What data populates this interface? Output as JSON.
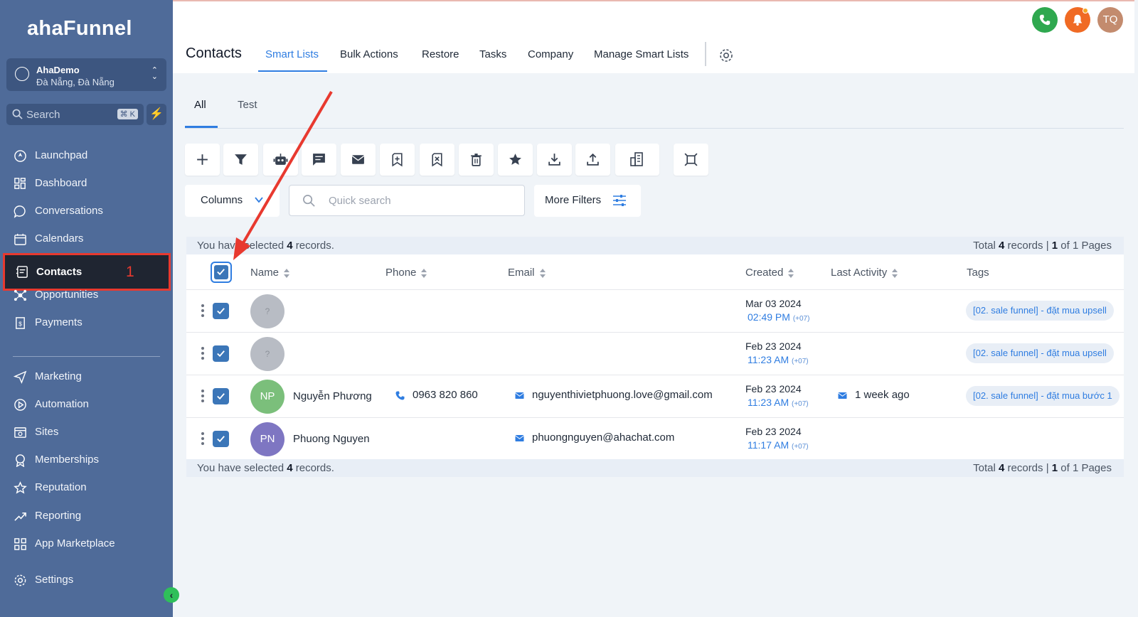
{
  "brand": {
    "logo": "ahaFunnel"
  },
  "account": {
    "name": "AhaDemo",
    "location": "Đà Nẵng, Đà Nẵng"
  },
  "sidebar_search": {
    "placeholder": "Search",
    "shortcut": "⌘ K"
  },
  "sidebar": {
    "items": [
      {
        "label": "Launchpad",
        "icon": "rocket-icon"
      },
      {
        "label": "Dashboard",
        "icon": "grid-icon"
      },
      {
        "label": "Conversations",
        "icon": "chat-bubble-icon"
      },
      {
        "label": "Calendars",
        "icon": "calendar-icon"
      },
      {
        "label": "Contacts",
        "icon": "contact-card-icon",
        "active": true,
        "annotation": "1"
      },
      {
        "label": "Opportunities",
        "icon": "network-icon"
      },
      {
        "label": "Payments",
        "icon": "receipt-icon"
      },
      {
        "label": "Marketing",
        "icon": "send-icon"
      },
      {
        "label": "Automation",
        "icon": "automation-icon"
      },
      {
        "label": "Sites",
        "icon": "sites-icon"
      },
      {
        "label": "Memberships",
        "icon": "badge-icon"
      },
      {
        "label": "Reputation",
        "icon": "star-icon"
      },
      {
        "label": "Reporting",
        "icon": "trend-icon"
      },
      {
        "label": "App Marketplace",
        "icon": "apps-icon"
      },
      {
        "label": "Settings",
        "icon": "gear-icon"
      }
    ]
  },
  "header": {
    "title": "Contacts",
    "tabs": [
      "Smart Lists",
      "Bulk Actions",
      "Restore",
      "Tasks",
      "Company",
      "Manage Smart Lists"
    ],
    "active_tab": "Smart Lists",
    "user_initials": "TQ"
  },
  "sub_tabs": [
    "All",
    "Test"
  ],
  "toolbar": {
    "icons": [
      "add-icon",
      "filter-icon",
      "robot-icon",
      "message-icon",
      "email-icon",
      "tag-add-icon",
      "tag-remove-icon",
      "trash-icon",
      "star-icon",
      "download-icon",
      "upload-icon",
      "company-icon",
      "merge-icon"
    ]
  },
  "controls": {
    "columns_label": "Columns",
    "quick_search_placeholder": "Quick search",
    "more_filters_label": "More Filters"
  },
  "selection": {
    "prefix": "You have selected ",
    "count": "4",
    "suffix": " records.",
    "total_prefix": "Total ",
    "total_count": "4",
    "total_mid": " records | ",
    "page_current": "1",
    "page_suffix": " of 1 Pages"
  },
  "table": {
    "columns": [
      "Name",
      "Phone",
      "Email",
      "Created",
      "Last Activity",
      "Tags"
    ],
    "rows": [
      {
        "initials": "?",
        "name": "",
        "phone": "",
        "email": "",
        "created_date": "Mar 03 2024",
        "created_time": "02:49 PM",
        "tz": "(+07)",
        "last_activity": "",
        "tag": "[02. sale funnel] - đặt mua upsell"
      },
      {
        "initials": "?",
        "name": "",
        "phone": "",
        "email": "",
        "created_date": "Feb 23 2024",
        "created_time": "11:23 AM",
        "tz": "(+07)",
        "last_activity": "",
        "tag": "[02. sale funnel] - đặt mua upsell"
      },
      {
        "initials": "NP",
        "name": "Nguyễn Phương",
        "phone": "0963 820 860",
        "email": "nguyenthivietphuong.love@gmail.com",
        "created_date": "Feb 23 2024",
        "created_time": "11:23 AM",
        "tz": "(+07)",
        "last_activity": "1 week ago",
        "tag": "[02. sale funnel] - đặt mua bước 1"
      },
      {
        "initials": "PN",
        "name": "Phuong Nguyen",
        "phone": "",
        "email": "phuongnguyen@ahachat.com",
        "created_date": "Feb 23 2024",
        "created_time": "11:17 AM",
        "tz": "(+07)",
        "last_activity": "",
        "tag": ""
      }
    ]
  },
  "colors": {
    "sidebar": "#4f6b99",
    "accent": "#2f7de1",
    "annotation": "#e8392f",
    "checkbox": "#3b76b8"
  }
}
